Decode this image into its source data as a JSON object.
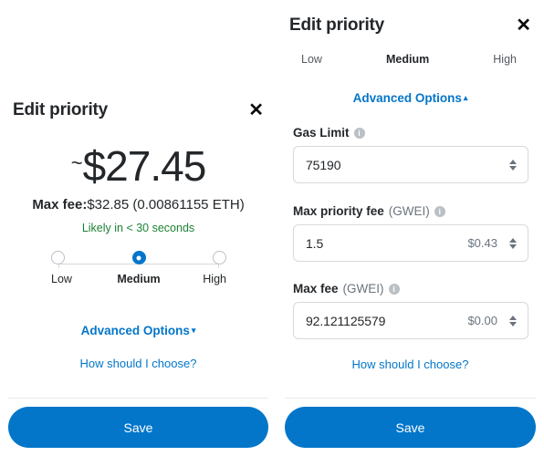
{
  "left_panel": {
    "title": "Edit priority",
    "close_label": "✕",
    "amount_tilde": "~",
    "amount_value": "$27.45",
    "max_fee_label": "Max fee:",
    "max_fee_value": "$32.85 (0.00861155 ETH)",
    "eta": "Likely in < 30 seconds",
    "options": [
      {
        "label": "Low",
        "selected": false
      },
      {
        "label": "Medium",
        "selected": true
      },
      {
        "label": "High",
        "selected": false
      }
    ],
    "advanced_options": "Advanced Options",
    "advanced_caret": "▾",
    "help_link": "How should I choose?",
    "save_label": "Save"
  },
  "right_panel": {
    "title": "Edit priority",
    "close_label": "✕",
    "options": [
      {
        "label": "Low",
        "selected": false
      },
      {
        "label": "Medium",
        "selected": true
      },
      {
        "label": "High",
        "selected": false
      }
    ],
    "advanced_options": "Advanced Options",
    "advanced_caret": "▴",
    "fields": [
      {
        "label": "Gas Limit",
        "unit": "",
        "info": "i",
        "value": "75190",
        "fiat": ""
      },
      {
        "label": "Max priority fee",
        "unit": "(GWEI)",
        "info": "i",
        "value": "1.5",
        "fiat": "$0.43"
      },
      {
        "label": "Max fee",
        "unit": "(GWEI)",
        "info": "i",
        "value": "92.121125579",
        "fiat": "$0.00"
      }
    ],
    "help_link": "How should I choose?",
    "save_label": "Save"
  },
  "colors": {
    "accent": "#0376c9",
    "text": "#24272a",
    "muted": "#6a737d",
    "success": "#1c8234",
    "border": "#d6d9dc"
  }
}
